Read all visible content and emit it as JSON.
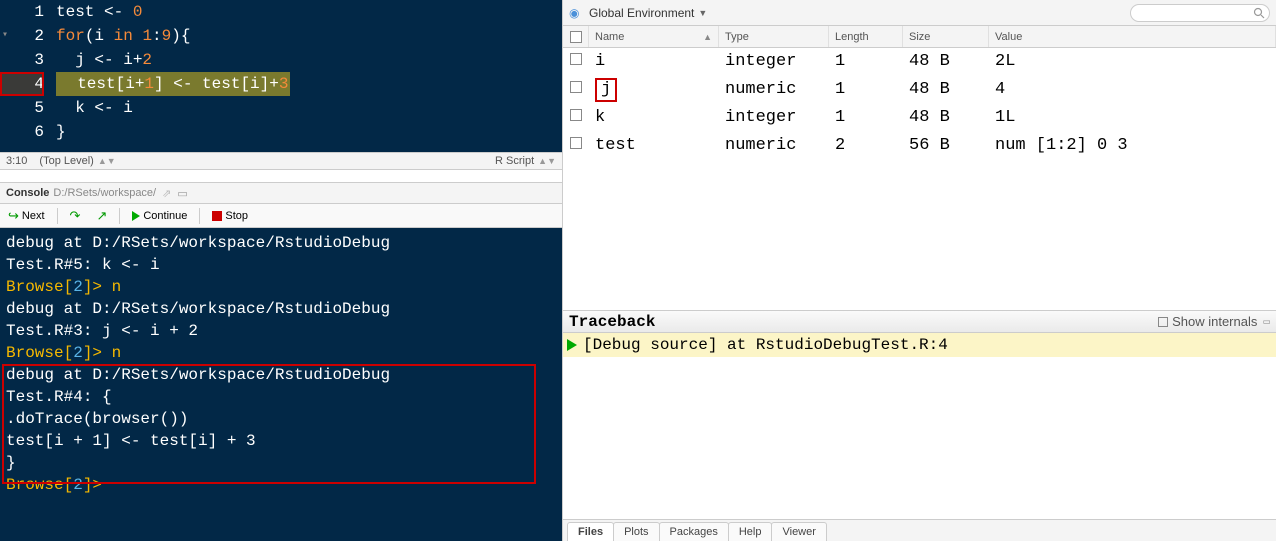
{
  "editor": {
    "lines": [
      {
        "n": "1",
        "html": "test <span style='color:#fff'>&lt;-</span> <span class='tok-num'>0</span>"
      },
      {
        "n": "2",
        "html": "<span class='tok-kw'>for</span>(i <span class='tok-kw'>in</span> <span class='tok-num'>1</span>:<span class='tok-num'>9</span>){",
        "fold": true
      },
      {
        "n": "3",
        "html": "  j &lt;- i+<span class='tok-num'>2</span>"
      },
      {
        "n": "4",
        "html": "<span class='code-hl'>  test[i+<span class='tok-num'>1</span>] &lt;- test[i]+<span class='tok-num'>3</span></span>",
        "bp": true
      },
      {
        "n": "5",
        "html": "  k &lt;- i"
      },
      {
        "n": "6",
        "html": "}"
      }
    ],
    "status_pos": "3:10",
    "status_scope": "(Top Level)",
    "status_lang": "R Script"
  },
  "console": {
    "title": "Console",
    "path": "D:/RSets/workspace/",
    "toolbar": {
      "next": "Next",
      "continue": "Continue",
      "stop": "Stop"
    },
    "lines": [
      {
        "cls": "c-white",
        "text": "debug at D:/RSets/workspace/RstudioDebug"
      },
      {
        "cls": "c-white",
        "text": "Test.R#5: k <- i"
      },
      {
        "cls": "",
        "html": "<span class='c-yellow'>Browse[</span><span class='c-blue'>2</span><span class='c-yellow'>]&gt; n</span>"
      },
      {
        "cls": "c-white",
        "text": "debug at D:/RSets/workspace/RstudioDebug"
      },
      {
        "cls": "c-white",
        "text": "Test.R#3: j <- i + 2"
      },
      {
        "cls": "",
        "html": "<span class='c-yellow'>Browse[</span><span class='c-blue'>2</span><span class='c-yellow'>]&gt; n</span>"
      },
      {
        "cls": "c-white",
        "text": "debug at D:/RSets/workspace/RstudioDebug"
      },
      {
        "cls": "c-white",
        "text": "Test.R#4: {"
      },
      {
        "cls": "c-white",
        "text": "    .doTrace(browser())"
      },
      {
        "cls": "c-white",
        "text": "    test[i + 1] <- test[i] + 3"
      },
      {
        "cls": "c-white",
        "text": "}"
      },
      {
        "cls": "",
        "html": "<span class='c-yellow'>Browse[</span><span class='c-blue'>2</span><span class='c-yellow'>]&gt;</span>"
      }
    ]
  },
  "environment": {
    "scope_label": "Global Environment",
    "search_placeholder": "",
    "cols": {
      "name": "Name",
      "type": "Type",
      "length": "Length",
      "size": "Size",
      "value": "Value"
    },
    "rows": [
      {
        "name": "i",
        "type": "integer",
        "length": "1",
        "size": "48 B",
        "value": "2L",
        "hl": false
      },
      {
        "name": "j",
        "type": "numeric",
        "length": "1",
        "size": "48 B",
        "value": "4",
        "hl": true
      },
      {
        "name": "k",
        "type": "integer",
        "length": "1",
        "size": "48 B",
        "value": "1L",
        "hl": false
      },
      {
        "name": "test",
        "type": "numeric",
        "length": "2",
        "size": "56 B",
        "value": "num [1:2] 0 3",
        "hl": false
      }
    ]
  },
  "traceback": {
    "title": "Traceback",
    "show_internals": "Show internals",
    "row": "[Debug source] at RstudioDebugTest.R:4"
  },
  "bottom_tabs": [
    "Files",
    "Plots",
    "Packages",
    "Help",
    "Viewer"
  ]
}
